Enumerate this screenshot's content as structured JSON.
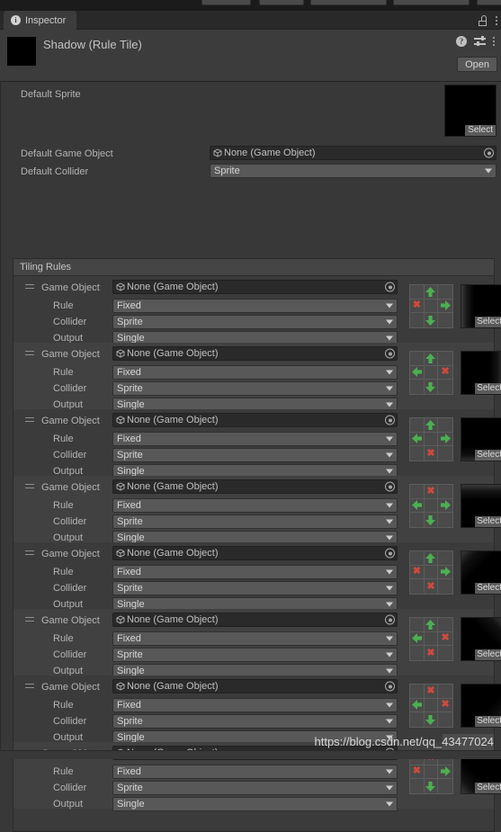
{
  "window": {
    "tab_label": "Inspector",
    "tab_icon": "info-icon",
    "lock_icon": "lock-icon",
    "menu_icon": "kebab-menu-icon"
  },
  "header": {
    "title": "Shadow (Rule Tile)",
    "help_icon": "help-icon",
    "preset_icon": "preset-icon",
    "menu_icon": "kebab-menu-icon",
    "open_label": "Open"
  },
  "properties": {
    "default_sprite_label": "Default Sprite",
    "default_sprite_select": "Select",
    "default_game_object_label": "Default Game Object",
    "default_game_object_value": "None (Game Object)",
    "default_collider_label": "Default Collider",
    "default_collider_value": "Sprite"
  },
  "tiling_rules": {
    "header": "Tiling Rules",
    "field_labels": {
      "game_object": "Game Object",
      "rule": "Rule",
      "collider": "Collider",
      "output": "Output"
    },
    "select_label": "Select",
    "rules": [
      {
        "game_object": "None (Game Object)",
        "rule": "Fixed",
        "collider": "Sprite",
        "output": "Single",
        "matrix": [
          "",
          "up",
          "",
          "x",
          "",
          "right",
          "",
          "down",
          ""
        ]
      },
      {
        "game_object": "None (Game Object)",
        "rule": "Fixed",
        "collider": "Sprite",
        "output": "Single",
        "matrix": [
          "",
          "up",
          "",
          "left",
          "",
          "x",
          "",
          "down",
          ""
        ]
      },
      {
        "game_object": "None (Game Object)",
        "rule": "Fixed",
        "collider": "Sprite",
        "output": "Single",
        "matrix": [
          "",
          "up",
          "",
          "left",
          "",
          "right",
          "",
          "x",
          ""
        ]
      },
      {
        "game_object": "None (Game Object)",
        "rule": "Fixed",
        "collider": "Sprite",
        "output": "Single",
        "matrix": [
          "",
          "x",
          "",
          "left",
          "",
          "right",
          "",
          "down",
          ""
        ]
      },
      {
        "game_object": "None (Game Object)",
        "rule": "Fixed",
        "collider": "Sprite",
        "output": "Single",
        "matrix": [
          "",
          "up",
          "",
          "x",
          "",
          "right",
          "",
          "x",
          ""
        ]
      },
      {
        "game_object": "None (Game Object)",
        "rule": "Fixed",
        "collider": "Sprite",
        "output": "Single",
        "matrix": [
          "",
          "up",
          "",
          "left",
          "",
          "x",
          "",
          "x",
          ""
        ]
      },
      {
        "game_object": "None (Game Object)",
        "rule": "Fixed",
        "collider": "Sprite",
        "output": "Single",
        "matrix": [
          "",
          "x",
          "",
          "left",
          "",
          "x",
          "",
          "down",
          ""
        ]
      },
      {
        "game_object": "None (Game Object)",
        "rule": "Fixed",
        "collider": "Sprite",
        "output": "Single",
        "matrix": [
          "",
          "x",
          "",
          "x",
          "",
          "right",
          "",
          "down",
          ""
        ]
      }
    ]
  },
  "watermark": "https://blog.csdn.net/qq_43477024",
  "colors": {
    "background": "#383838",
    "panel": "#3b3b3b",
    "panel_alt": "#414141",
    "tabbar": "#292929",
    "dropdown": "#585858",
    "field": "#2a2a2a",
    "arrow_green": "#4caf50",
    "x_red": "#d04a3c",
    "text": "#b4b4b4"
  }
}
